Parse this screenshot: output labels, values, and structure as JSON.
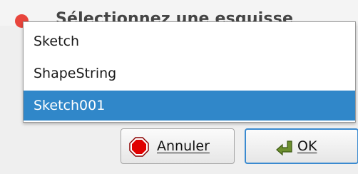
{
  "dialog": {
    "title": "Sélectionnez une esquisse"
  },
  "dropdown": {
    "options": [
      {
        "label": "Sketch",
        "selected": false
      },
      {
        "label": "ShapeString",
        "selected": false
      },
      {
        "label": "Sketch001",
        "selected": true
      }
    ],
    "selected_color": "#3087c9"
  },
  "buttons": {
    "cancel_label": "Annuler",
    "cancel_icon": "stop-icon",
    "ok_label": "OK",
    "ok_icon": "ok-arrow-icon"
  },
  "colors": {
    "close_button": "#e8453c",
    "focus_border": "#3a8ad0"
  }
}
